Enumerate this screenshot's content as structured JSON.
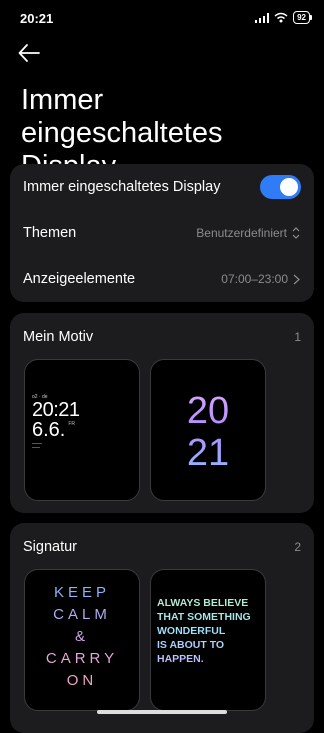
{
  "status_bar": {
    "time": "20:21",
    "battery": "92",
    "icons": [
      "signal-icon",
      "wifi-icon",
      "battery-icon"
    ]
  },
  "header": {
    "back_icon": "arrow-left-icon",
    "title": "Immer eingeschaltetes Display"
  },
  "settings": {
    "always_on": {
      "label": "Immer eingeschaltetes Display",
      "enabled": true
    },
    "themes": {
      "label": "Themen",
      "value": "Benutzerdefiniert"
    },
    "elements": {
      "label": "Anzeigeelemente",
      "value": "07:00–23:00"
    }
  },
  "my_motif": {
    "title": "Mein Motiv",
    "count": "1",
    "thumb1": {
      "date_small": "o2 · de",
      "time": "20:21",
      "date": "6.6.",
      "weekday": "FR"
    },
    "thumb2": {
      "hour": "20",
      "minute": "21"
    }
  },
  "signature": {
    "title": "Signatur",
    "count": "2",
    "keep_calm": [
      "KEEP",
      "CALM",
      "&",
      "CARRY",
      "ON"
    ],
    "believe": [
      "ALWAYS BELIEVE",
      "THAT SOMETHING",
      "WONDERFUL",
      "IS ABOUT TO",
      "HAPPEN."
    ]
  },
  "colors": {
    "accent": "#2f7cf6",
    "card": "#1c1c1e",
    "muted_text": "#8b8b90"
  }
}
